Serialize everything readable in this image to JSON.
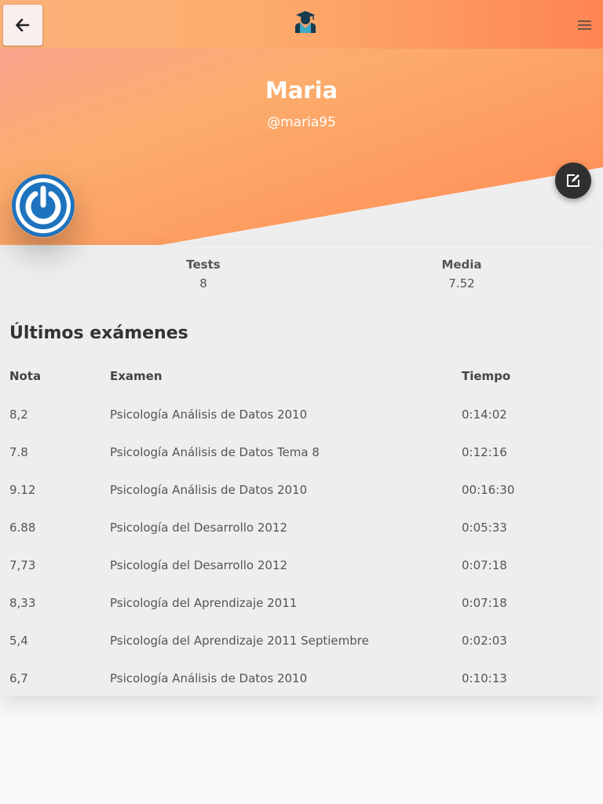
{
  "header": {
    "back_icon": "arrow-left-icon",
    "logo_icon": "graduate-icon",
    "menu_icon": "hamburger-menu-icon"
  },
  "profile": {
    "name": "Maria",
    "handle": "@maria95",
    "edit_icon": "edit-icon",
    "avatar_icon": "power-icon"
  },
  "stats": {
    "tests_label": "Tests",
    "tests_value": "8",
    "media_label": "Media",
    "media_value": "7.52"
  },
  "exams": {
    "title": "Últimos exámenes",
    "headers": {
      "nota": "Nota",
      "examen": "Examen",
      "tiempo": "Tiempo"
    },
    "rows": [
      {
        "nota": "8,2",
        "examen": "Psicología Análisis de Datos 2010",
        "tiempo": "0:14:02"
      },
      {
        "nota": "7.8",
        "examen": "Psicología Análisis de Datos Tema 8",
        "tiempo": "0:12:16"
      },
      {
        "nota": "9.12",
        "examen": "Psicología Análisis de Datos 2010",
        "tiempo": "00:16:30"
      },
      {
        "nota": "6.88",
        "examen": "Psicología del Desarrollo 2012",
        "tiempo": "0:05:33"
      },
      {
        "nota": "7,73",
        "examen": "Psicología del Desarrollo 2012",
        "tiempo": "0:07:18"
      },
      {
        "nota": "8,33",
        "examen": "Psicología del Aprendizaje 2011",
        "tiempo": "0:07:18"
      },
      {
        "nota": "5,4",
        "examen": "Psicología del Aprendizaje 2011 Septiembre",
        "tiempo": "0:02:03"
      },
      {
        "nota": "6,7",
        "examen": "Psicología Análisis de Datos 2010",
        "tiempo": "0:10:13"
      }
    ]
  },
  "colors": {
    "hero_start": "#f9a19a",
    "hero_mid": "#fcad6c",
    "hero_end": "#ff8a56",
    "avatar_blue": "#1e73be",
    "fab_dark": "#303030"
  }
}
